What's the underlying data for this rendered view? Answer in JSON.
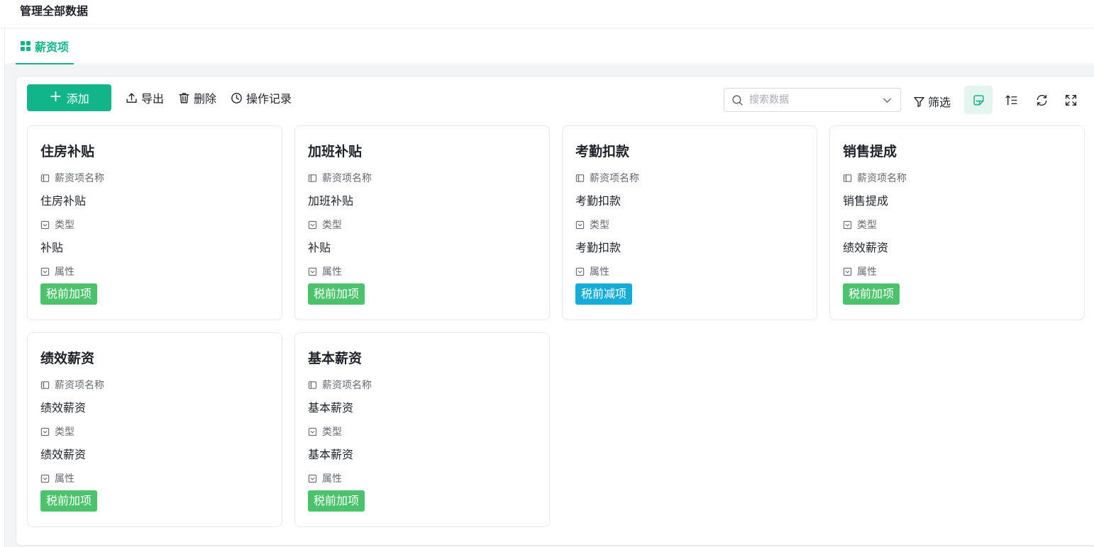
{
  "page": {
    "title": "管理全部数据"
  },
  "tabs": [
    {
      "label": "薪资项",
      "icon": "grid-icon",
      "active": true
    }
  ],
  "toolbar": {
    "add_label": "添加",
    "export_label": "导出",
    "delete_label": "删除",
    "history_label": "操作记录",
    "search_placeholder": "搜索数据",
    "filter_label": "筛选"
  },
  "colors": {
    "accent": "#12b48a",
    "tag_green": "#4cc26d",
    "tag_cyan": "#16acd8"
  },
  "field_labels": {
    "name": "薪资项名称",
    "type": "类型",
    "attr": "属性"
  },
  "cards": [
    {
      "title": "住房补贴",
      "name": "住房补贴",
      "type": "补贴",
      "attr": "税前加项",
      "tag_color": "green"
    },
    {
      "title": "加班补贴",
      "name": "加班补贴",
      "type": "补贴",
      "attr": "税前加项",
      "tag_color": "green"
    },
    {
      "title": "考勤扣款",
      "name": "考勤扣款",
      "type": "考勤扣款",
      "attr": "税前减项",
      "tag_color": "cyan"
    },
    {
      "title": "销售提成",
      "name": "销售提成",
      "type": "绩效薪资",
      "attr": "税前加项",
      "tag_color": "green"
    },
    {
      "title": "绩效薪资",
      "name": "绩效薪资",
      "type": "绩效薪资",
      "attr": "税前加项",
      "tag_color": "green"
    },
    {
      "title": "基本薪资",
      "name": "基本薪资",
      "type": "基本薪资",
      "attr": "税前加项",
      "tag_color": "green"
    }
  ]
}
